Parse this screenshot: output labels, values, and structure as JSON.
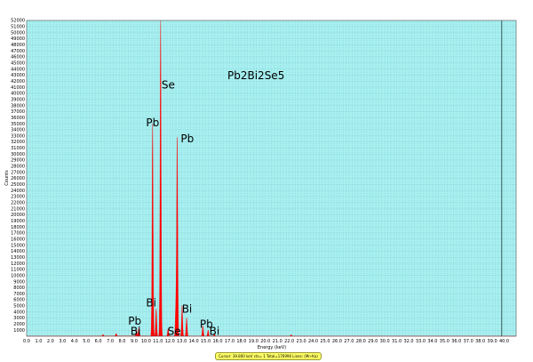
{
  "status_bar": "Cursor: 39.800 keV  cts= 1  Total=176996  Lines: (Mn-Ka)",
  "colors": {
    "plot_background": "#a8f0f0",
    "grid": "#6fb7c7",
    "spectrum": "#ff0000",
    "marker": "#000000"
  },
  "chart_data": {
    "type": "area",
    "title": "Pb2Bi2Se5",
    "xlabel": "Energy (keV)",
    "ylabel": "Counts",
    "xlim": [
      0,
      41
    ],
    "ylim": [
      0,
      52000
    ],
    "x_ticks": [
      "0.0",
      "1.0",
      "2.0",
      "3.0",
      "4.0",
      "5.0",
      "6.0",
      "7.0",
      "8.0",
      "9.0",
      "10.0",
      "11.0",
      "12.0",
      "13.0",
      "14.0",
      "15.0",
      "16.0",
      "17.0",
      "18.0",
      "19.0",
      "20.0",
      "21.0",
      "22.0",
      "23.0",
      "24.0",
      "25.0",
      "26.0",
      "27.0",
      "28.0",
      "29.0",
      "30.0",
      "31.0",
      "32.0",
      "33.0",
      "34.0",
      "35.0",
      "36.0",
      "37.0",
      "38.0",
      "39.0",
      "40.0"
    ],
    "y_ticks": [
      "1000",
      "2000",
      "3000",
      "4000",
      "5000",
      "6000",
      "7000",
      "8000",
      "9000",
      "10000",
      "11000",
      "12000",
      "13000",
      "14000",
      "15000",
      "16000",
      "17000",
      "18000",
      "19000",
      "20000",
      "21000",
      "22000",
      "23000",
      "24000",
      "25000",
      "26000",
      "27000",
      "28000",
      "29000",
      "30000",
      "31000",
      "32000",
      "33000",
      "34000",
      "35000",
      "36000",
      "37000",
      "38000",
      "39000",
      "40000",
      "41000",
      "42000",
      "43000",
      "44000",
      "45000",
      "46000",
      "47000",
      "48000",
      "49000",
      "50000",
      "51000",
      "52000"
    ],
    "grid": true,
    "cursor_x": 39.8,
    "peaks": [
      {
        "x": 6.4,
        "y": 250
      },
      {
        "x": 7.5,
        "y": 400
      },
      {
        "x": 9.2,
        "y": 1000
      },
      {
        "x": 9.4,
        "y": 1400
      },
      {
        "x": 10.55,
        "y": 35000
      },
      {
        "x": 10.85,
        "y": 4500
      },
      {
        "x": 11.22,
        "y": 52000
      },
      {
        "x": 11.85,
        "y": 1200
      },
      {
        "x": 12.5,
        "y": 5200
      },
      {
        "x": 12.61,
        "y": 32500
      },
      {
        "x": 13.02,
        "y": 5000
      },
      {
        "x": 13.4,
        "y": 3000
      },
      {
        "x": 14.76,
        "y": 1700
      },
      {
        "x": 15.2,
        "y": 1000
      },
      {
        "x": 15.73,
        "y": 300
      },
      {
        "x": 22.16,
        "y": 250
      }
    ],
    "annotations": [
      {
        "text": "Se",
        "x": 11.3,
        "y": 40800
      },
      {
        "text": "Pb",
        "x": 10.0,
        "y": 34600
      },
      {
        "text": "Pb",
        "x": 12.9,
        "y": 31900
      },
      {
        "text": "Bi",
        "x": 10.0,
        "y": 4900
      },
      {
        "text": "Bi",
        "x": 13.0,
        "y": 3900
      },
      {
        "text": "Pb",
        "x": 8.5,
        "y": 1900
      },
      {
        "text": "Pb",
        "x": 14.5,
        "y": 1400
      },
      {
        "text": "Bi",
        "x": 8.7,
        "y": 200
      },
      {
        "text": "Se",
        "x": 11.8,
        "y": 200
      },
      {
        "text": "Bi",
        "x": 15.3,
        "y": 200
      }
    ]
  }
}
